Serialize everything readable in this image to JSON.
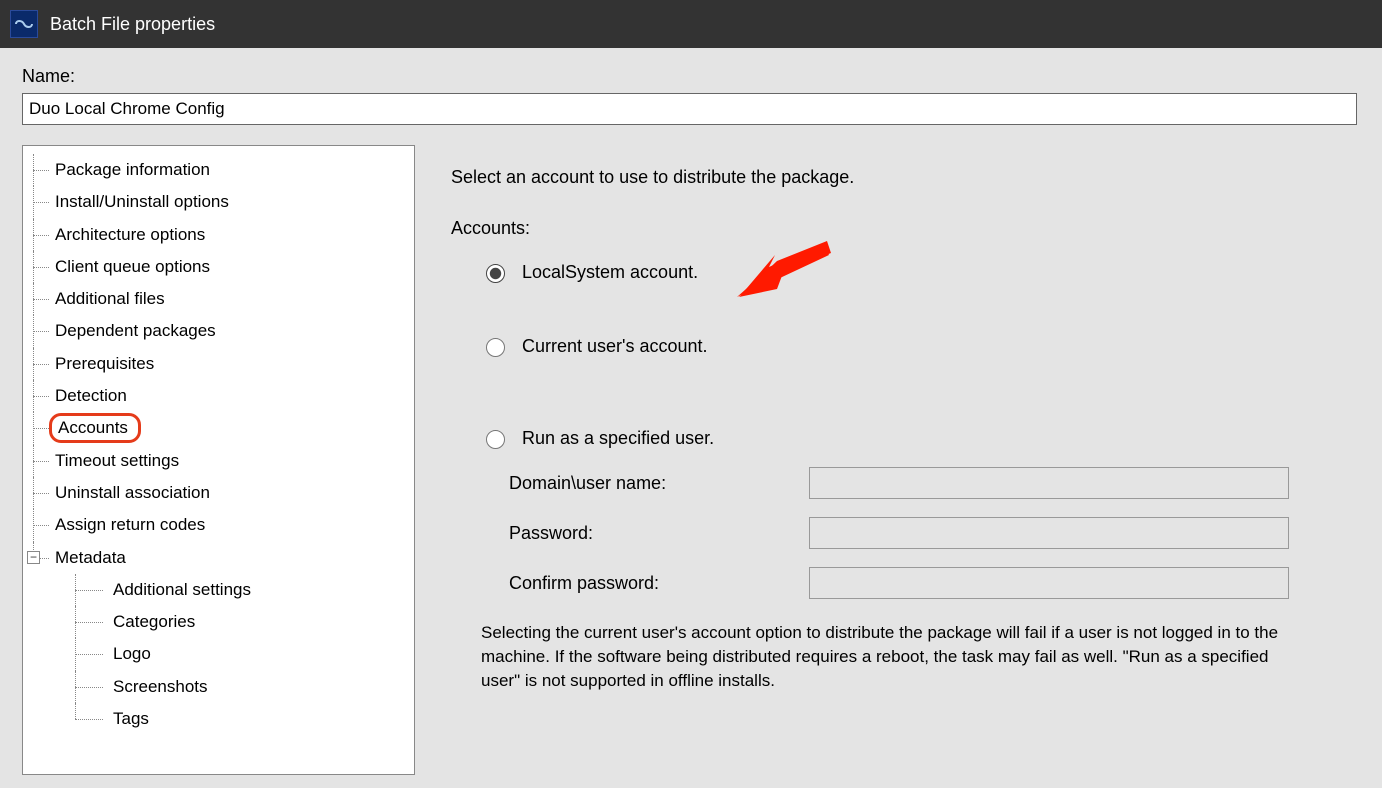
{
  "window": {
    "title": "Batch File properties"
  },
  "name_section": {
    "label": "Name:",
    "value": "Duo Local Chrome Config"
  },
  "tree": {
    "items": [
      "Package information",
      "Install/Uninstall options",
      "Architecture options",
      "Client queue options",
      "Additional files",
      "Dependent packages",
      "Prerequisites",
      "Detection",
      "Accounts",
      "Timeout settings",
      "Uninstall association",
      "Assign return codes"
    ],
    "metadata_label": "Metadata",
    "metadata_expander": "−",
    "metadata_children": [
      "Additional settings",
      "Categories",
      "Logo",
      "Screenshots",
      "Tags"
    ]
  },
  "pane": {
    "instruction": "Select an account to use to distribute the package.",
    "accounts_label": "Accounts:",
    "radio_localsystem": "LocalSystem account.",
    "radio_currentuser": "Current user's account.",
    "radio_specified": "Run as a specified user.",
    "field_domain_label": "Domain\\user name:",
    "field_domain_value": "",
    "field_password_label": "Password:",
    "field_password_value": "",
    "field_confirm_label": "Confirm password:",
    "field_confirm_value": "",
    "help_text": "Selecting the current user's account option to distribute the package will fail if a user is not logged in to the machine. If the software being distributed requires a reboot, the task may fail as well.  \"Run as a specified user\" is not supported in offline installs."
  }
}
